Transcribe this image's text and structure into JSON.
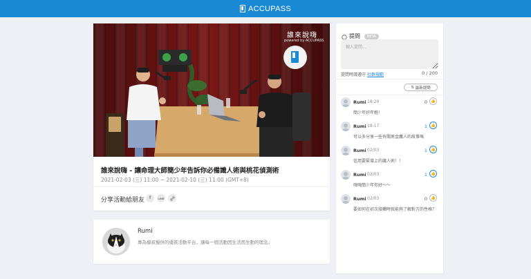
{
  "header": {
    "brand": "ACCUPASS",
    "color": "#1a8ad6"
  },
  "event": {
    "cover_text_main": "誰來說嗨",
    "cover_text_sub": "powered by ACCUPASS",
    "title": "誰來說嗨 - 讓命理大師簡少年告訴你必備識人術與桃花偵測術",
    "date": "2021-02-03 (三) 11:00 ~ 2021-02-10 (三) 11:00 (GMT+8)",
    "share_label": "分享活動給朋友",
    "share_icons": [
      "f",
      "LINE",
      "link-icon"
    ]
  },
  "host": {
    "name": "Rumi",
    "description": "專為模叔擬供的優質活動平台，讓每一個活動因生活而生動的理念。"
  },
  "qa": {
    "title": "提問",
    "badge": "BETA",
    "input_placeholder": "輸入提問...",
    "rules_prefix": "提問時請遵守",
    "rules_link": "社群規範",
    "char_count": "0 / 200",
    "sort_label": "最新提問",
    "questions": [
      {
        "name": "Rumi",
        "time": "18:20",
        "likes": "0",
        "liked": false,
        "text": "簡少年好年輕！"
      },
      {
        "name": "Rumi",
        "time": "18:17",
        "likes": "1",
        "liked": true,
        "text": "可以多分享一些有關男金鷹人的故事嗎"
      },
      {
        "name": "Rumi",
        "time": "02/03",
        "likes": "1",
        "liked": true,
        "text": "信用要緊增上的識人術！！"
      },
      {
        "name": "Rumi",
        "time": "02/03",
        "likes": "1",
        "liked": true,
        "text": "嗨嗨簡少年你好～～"
      },
      {
        "name": "Rumi",
        "time": "02/03",
        "likes": "0",
        "liked": false,
        "text": "要如何在初次接觸時就能夠了解對方的性格？"
      }
    ]
  }
}
